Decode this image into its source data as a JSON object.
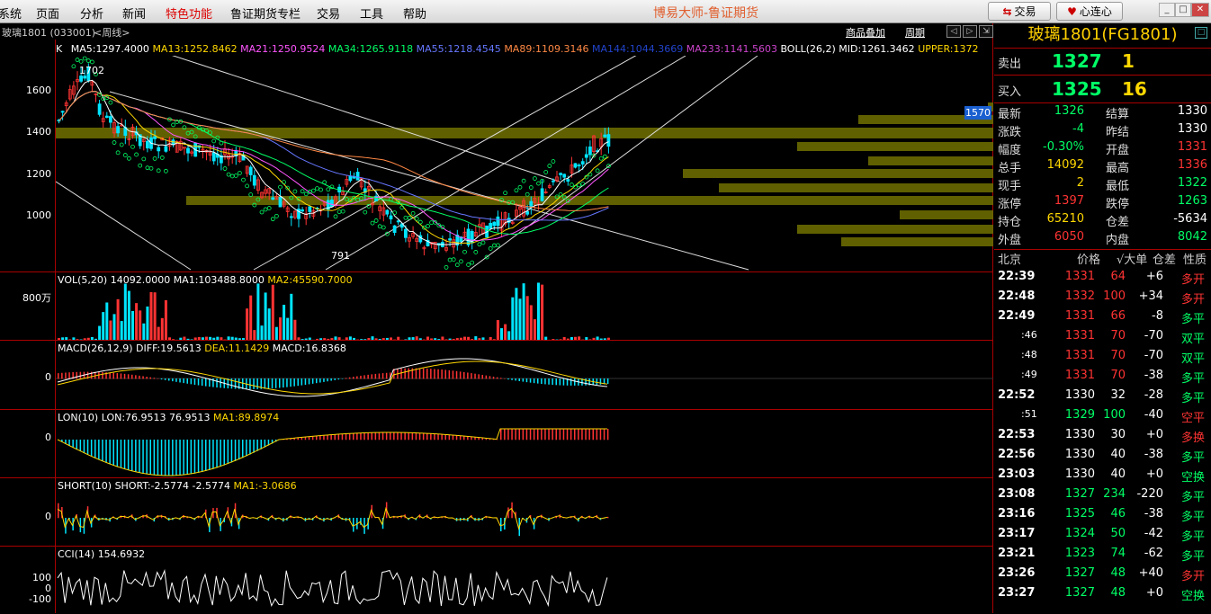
{
  "menu": {
    "items": [
      "系统",
      "页面",
      "分析",
      "新闻",
      "特色功能",
      "鲁证期货专栏",
      "交易",
      "工具",
      "帮助"
    ],
    "app_title": "博易大师-鲁证期货",
    "trade_btn": "交易",
    "heart_btn": "心连心"
  },
  "header": {
    "symbol": "玻璃1801 (033001)",
    "period": "<周线>",
    "overlay_link": "商品叠加",
    "period_link": "周期"
  },
  "main_indicator": {
    "k": "K",
    "ma5": "MA5:1297.4000",
    "ma13": "MA13:1252.8462",
    "ma21": "MA21:1250.9524",
    "ma34": "MA34:1265.9118",
    "ma55": "MA55:1218.4545",
    "ma89": "MA89:1109.3146",
    "ma144": "MA144:1044.3669",
    "ma233": "MA233:1141.5603",
    "boll": "BOLL(26,2)",
    "mid": "MID:1261.3462",
    "upper": "UPPER:1372",
    "high_label": "1702",
    "low_label": "791",
    "price_tag": "1570",
    "y_ticks": [
      "1600",
      "1400",
      "1200",
      "1000"
    ]
  },
  "vol_panel": {
    "label": "VOL(5,20)",
    "vol": "14092.0000",
    "ma1": "MA1:103488.8000",
    "ma2": "MA2:45590.7000",
    "y_tick": "800万"
  },
  "macd_panel": {
    "label": "MACD(26,12,9)",
    "diff": "DIFF:19.5613",
    "dea": "DEA:11.1429",
    "macd": "MACD:16.8368",
    "y_tick": "0"
  },
  "lon_panel": {
    "label": "LON(10)",
    "lon": "LON:76.9513",
    "val": "76.9513",
    "ma1": "MA1:89.8974",
    "y_tick": "0"
  },
  "short_panel": {
    "label": "SHORT(10)",
    "short": "SHORT:-2.5774",
    "val": "-2.5774",
    "ma1": "MA1:-3.0686",
    "y_tick": "0"
  },
  "cci_panel": {
    "label": "CCI(14)",
    "val": "154.6932",
    "y_ticks": [
      "100",
      "0",
      "-100"
    ]
  },
  "quote": {
    "title": "玻璃1801(FG1801)",
    "sell_label": "卖出",
    "sell_price": "1327",
    "sell_qty": "1",
    "buy_label": "买入",
    "buy_price": "1325",
    "buy_qty": "16",
    "rows": [
      {
        "l1": "最新",
        "v1": "1326",
        "l2": "结算",
        "v2": "1330"
      },
      {
        "l1": "涨跌",
        "v1": "-4",
        "l2": "昨结",
        "v2": "1330"
      },
      {
        "l1": "幅度",
        "v1": "-0.30%",
        "l2": "开盘",
        "v2": "1331"
      },
      {
        "l1": "总手",
        "v1": "14092",
        "l2": "最高",
        "v2": "1336"
      },
      {
        "l1": "现手",
        "v1": "2",
        "l2": "最低",
        "v2": "1322"
      },
      {
        "l1": "涨停",
        "v1": "1397",
        "l2": "跌停",
        "v2": "1263"
      },
      {
        "l1": "持仓",
        "v1": "65210",
        "l2": "仓差",
        "v2": "-5634"
      },
      {
        "l1": "外盘",
        "v1": "6050",
        "l2": "内盘",
        "v2": "8042"
      }
    ],
    "trade_header": {
      "time": "北京",
      "price": "价格",
      "vol": "√大单",
      "diff": "仓差",
      "type": "性质"
    },
    "trades": [
      {
        "time": "22:39",
        "price": "1331",
        "vol": "64",
        "diff": "+6",
        "type": "多开"
      },
      {
        "time": "22:48",
        "price": "1332",
        "vol": "100",
        "diff": "+34",
        "type": "多开"
      },
      {
        "time": "22:49",
        "price": "1331",
        "vol": "66",
        "diff": "-8",
        "type": "多平"
      },
      {
        "time": ":46",
        "price": "1331",
        "vol": "70",
        "diff": "-70",
        "type": "双平"
      },
      {
        "time": ":48",
        "price": "1331",
        "vol": "70",
        "diff": "-70",
        "type": "双平"
      },
      {
        "time": ":49",
        "price": "1331",
        "vol": "70",
        "diff": "-38",
        "type": "多平"
      },
      {
        "time": "22:52",
        "price": "1330",
        "vol": "32",
        "diff": "-28",
        "type": "多平"
      },
      {
        "time": ":51",
        "price": "1329",
        "vol": "100",
        "diff": "-40",
        "type": "空平"
      },
      {
        "time": "22:53",
        "price": "1330",
        "vol": "30",
        "diff": "+0",
        "type": "多换"
      },
      {
        "time": "22:56",
        "price": "1330",
        "vol": "40",
        "diff": "-38",
        "type": "多平"
      },
      {
        "time": "23:03",
        "price": "1330",
        "vol": "40",
        "diff": "+0",
        "type": "空换"
      },
      {
        "time": "23:08",
        "price": "1327",
        "vol": "234",
        "diff": "-220",
        "type": "多平"
      },
      {
        "time": "23:16",
        "price": "1325",
        "vol": "46",
        "diff": "-38",
        "type": "多平"
      },
      {
        "time": "23:17",
        "price": "1324",
        "vol": "50",
        "diff": "-42",
        "type": "多平"
      },
      {
        "time": "23:21",
        "price": "1323",
        "vol": "74",
        "diff": "-62",
        "type": "多平"
      },
      {
        "time": "23:26",
        "price": "1327",
        "vol": "48",
        "diff": "+40",
        "type": "多开"
      },
      {
        "time": "23:27",
        "price": "1327",
        "vol": "48",
        "diff": "+0",
        "type": "空换"
      }
    ]
  },
  "colors": {
    "up": "#ff3333",
    "down": "#00ff66",
    "yellow": "#ffd700",
    "white": "#ffffff",
    "border": "#aa0000"
  }
}
